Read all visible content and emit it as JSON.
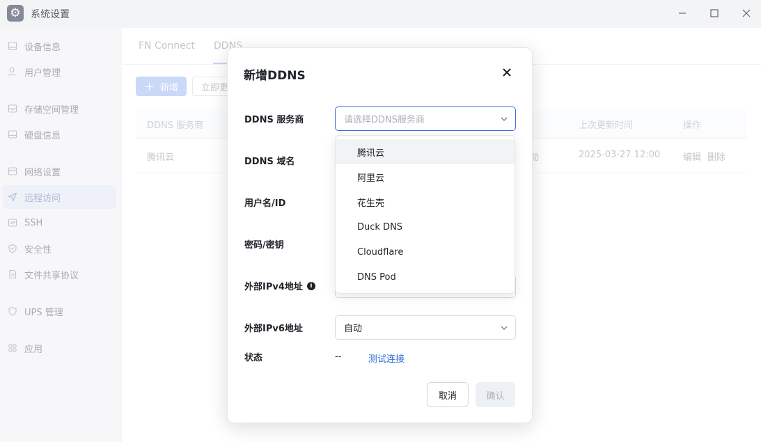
{
  "window": {
    "title": "系统设置",
    "app_icon": "gear-icon"
  },
  "sidebar": {
    "items": [
      {
        "label": "设备信息",
        "icon": "monitor-icon"
      },
      {
        "label": "用户管理",
        "icon": "user-icon"
      },
      {
        "label": "存储空间管理",
        "icon": "storage-icon"
      },
      {
        "label": "硬盘信息",
        "icon": "disk-icon"
      },
      {
        "label": "网络设置",
        "icon": "network-icon"
      },
      {
        "label": "远程访问",
        "icon": "send-icon",
        "active": true
      },
      {
        "label": "SSH",
        "icon": "terminal-icon"
      },
      {
        "label": "安全性",
        "icon": "shield-check-icon"
      },
      {
        "label": "文件共享协议",
        "icon": "document-icon"
      },
      {
        "label": "UPS 管理",
        "icon": "shield-icon"
      },
      {
        "label": "应用",
        "icon": "apps-icon"
      }
    ]
  },
  "main": {
    "tabs": [
      {
        "label": "FN Connect"
      },
      {
        "label": "DDNS",
        "active": true
      }
    ],
    "toolbar": {
      "new_label": "新增",
      "update_label": "立即更"
    },
    "table": {
      "headers": [
        "DDNS 服务商",
        "上次更新时间",
        "操作"
      ],
      "rows": [
        {
          "provider": "腾讯云",
          "status_fragment": "动",
          "updated": "2025-03-27 12:00",
          "edit": "编辑",
          "delete": "删除"
        }
      ]
    }
  },
  "modal": {
    "title": "新增DDNS",
    "fields": {
      "provider_label": "DDNS 服务商",
      "provider_placeholder": "请选择DDNS服务商",
      "domain_label": "DDNS 域名",
      "username_label": "用户名/ID",
      "password_label": "密码/密钥",
      "ipv4_label": "外部IPv4地址",
      "ipv6_label": "外部IPv6地址",
      "ipv6_value": "自动",
      "status_label": "状态",
      "status_value": "--",
      "test_link": "测试连接"
    },
    "buttons": {
      "cancel": "取消",
      "ok": "确认"
    }
  },
  "dropdown": {
    "options": [
      "腾讯云",
      "阿里云",
      "花生壳",
      "Duck DNS",
      "Cloudflare",
      "DNS Pod"
    ],
    "hovered": "腾讯云"
  },
  "colors": {
    "accent": "#2e6fd8",
    "focus_border": "#3d6fd8",
    "sidebar_active_bg": "#e9edf5"
  }
}
